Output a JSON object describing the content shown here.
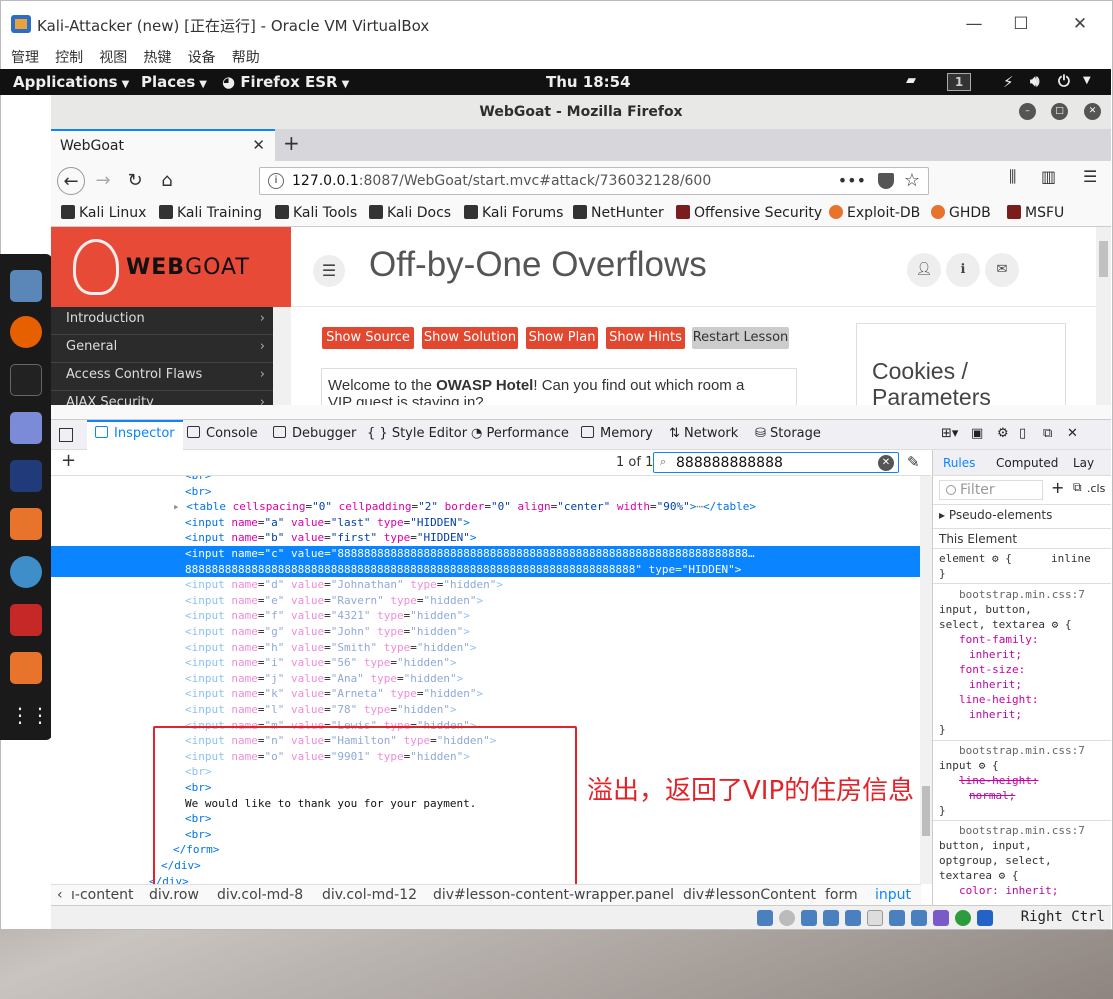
{
  "vbox": {
    "title": "Kali-Attacker (new) [正在运行] - Oracle VM VirtualBox",
    "menu": [
      "管理",
      "控制",
      "视图",
      "热键",
      "设备",
      "帮助"
    ],
    "host_key": "Right Ctrl"
  },
  "kali_bar": {
    "applications": "Applications",
    "places": "Places",
    "firefox": "Firefox ESR",
    "clock": "Thu 18:54",
    "workspace": "1"
  },
  "firefox": {
    "window_title": "WebGoat - Mozilla Firefox",
    "tab_label": "WebGoat",
    "url_host": "127.0.0.1",
    "url_rest": ":8087/WebGoat/start.mvc#attack/736032128/600",
    "bookmarks": [
      "Kali Linux",
      "Kali Training",
      "Kali Tools",
      "Kali Docs",
      "Kali Forums",
      "NetHunter",
      "Offensive Security",
      "Exploit-DB",
      "GHDB",
      "MSFU"
    ]
  },
  "page": {
    "logo_bold": "WEB",
    "logo_light": "GOAT",
    "title": "Off-by-One Overflows",
    "nav": [
      "Introduction",
      "General",
      "Access Control Flaws",
      "AJAX Security"
    ],
    "buttons": [
      "Show Source",
      "Show Solution",
      "Show Plan",
      "Show Hints",
      "Restart Lesson"
    ],
    "welcome_pre": "Welcome to the ",
    "welcome_bold": "OWASP Hotel",
    "welcome_post": "! Can you find out which room a",
    "welcome_line2": "VIP guest is staying in?",
    "cookies_title_1": "Cookies /",
    "cookies_title_2": "Parameters"
  },
  "devtools": {
    "tabs": [
      "Inspector",
      "Console",
      "Debugger",
      "Style Editor",
      "Performance",
      "Memory",
      "Network",
      "Storage"
    ],
    "match_count": "1 of 1",
    "search_value": "888888888888",
    "breadcrumbs": [
      "ı-content",
      "div.row",
      "div.col-md-8",
      "div.col-md-12",
      "div#lesson-content-wrapper.panel",
      "div#lessonContent",
      "form",
      "input"
    ],
    "rules_tabs": [
      "Rules",
      "Computed",
      "Lay"
    ],
    "filter_placeholder": "Filter",
    "cls_label": ".cls",
    "pseudo_elements": "Pseudo-elements",
    "this_element": "This Element"
  },
  "markup": {
    "table_line": {
      "cellspacing": "0",
      "cellpadding": "2",
      "border": "0",
      "align": "center",
      "width": "90%"
    },
    "input_a": {
      "name": "a",
      "value": "last",
      "type": "HIDDEN"
    },
    "input_b": {
      "name": "b",
      "value": "first",
      "type": "HIDDEN"
    },
    "input_c_value_1": "88888888888888888888888888888888888888888888888888888888888888…",
    "input_c_value_2": "88888888888888888888888888888888888888888888888888888888888888888888\"",
    "hidden_inputs": [
      {
        "name": "d",
        "value": "Johnathan"
      },
      {
        "name": "e",
        "value": "Ravern"
      },
      {
        "name": "f",
        "value": "4321"
      },
      {
        "name": "g",
        "value": "John"
      },
      {
        "name": "h",
        "value": "Smith"
      },
      {
        "name": "i",
        "value": "56"
      },
      {
        "name": "j",
        "value": "Ana"
      },
      {
        "name": "k",
        "value": "Arneta"
      },
      {
        "name": "l",
        "value": "78"
      },
      {
        "name": "m",
        "value": "Lewis"
      },
      {
        "name": "n",
        "value": "Hamilton"
      },
      {
        "name": "o",
        "value": "9901"
      }
    ],
    "thanks_text": "We would like to thank you for your payment."
  },
  "rules_pane": {
    "element_rule": "element",
    "element_value": "inline",
    "source": "bootstrap.min.css:7",
    "rule1_selector_1": "input, button,",
    "rule1_selector_2": "select, textarea",
    "rule1_props": [
      [
        "font-family:",
        "inherit;"
      ],
      [
        "font-size:",
        "inherit;"
      ],
      [
        "line-height:",
        "inherit;"
      ]
    ],
    "rule2_selector": "input",
    "rule2_prop": "line-height:",
    "rule2_val": "normal;",
    "rule3_selector_1": "button, input,",
    "rule3_selector_2": "optgroup, select,",
    "rule3_selector_3": "textarea",
    "rule3_prop": "color:",
    "rule3_val": "inherit;"
  },
  "annotation": "溢出，返回了VIP的住房信息"
}
